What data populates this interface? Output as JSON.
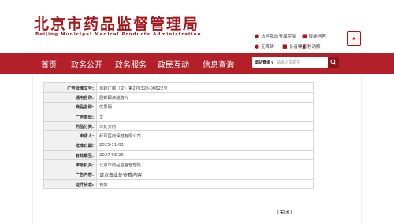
{
  "header": {
    "title": "北京市药品监督管理局",
    "subtitle": "Beijing Municipal Medical Products Administration",
    "quick_links": {
      "personal_space": "访问我的专属空间",
      "smart_qa": "智能问答",
      "accessibility": "无障碍",
      "elderly_mode": "长者模式",
      "mobile": "移动版"
    }
  },
  "nav": {
    "items": [
      "首页",
      "政务公开",
      "政务服务",
      "政民互动",
      "信息查询"
    ]
  },
  "search": {
    "scope": "本站查询",
    "placeholder": "请输入关键字"
  },
  "detail": {
    "rows": [
      {
        "label": "广告批准文号:",
        "value": "京药广审（文）第270320-00622号"
      },
      {
        "label": "通用名称:",
        "value": "屈螺酮炔雌醇片"
      },
      {
        "label": "商品名称:",
        "value": "优思明"
      },
      {
        "label": "广告类型:",
        "value": "文"
      },
      {
        "label": "药品分类:",
        "value": "非处方药"
      },
      {
        "label": "申请人:",
        "value": "拜耳医药保健有限公司"
      },
      {
        "label": "批准日期:",
        "value": "2025-11-03"
      },
      {
        "label": "有效期至:",
        "value": "2027-03-20"
      },
      {
        "label": "审批机关:",
        "value": "北京市药品监督管理局"
      },
      {
        "label": "广告内容:",
        "value": "请点击此处查看内容"
      },
      {
        "label": "证件状态:",
        "value": "有效"
      }
    ]
  },
  "close_label": "[关闭]",
  "colors": {
    "brand_red": "#a4161a",
    "nav_red": "#b3202a",
    "table_key_bg": "#f1f1f1"
  }
}
